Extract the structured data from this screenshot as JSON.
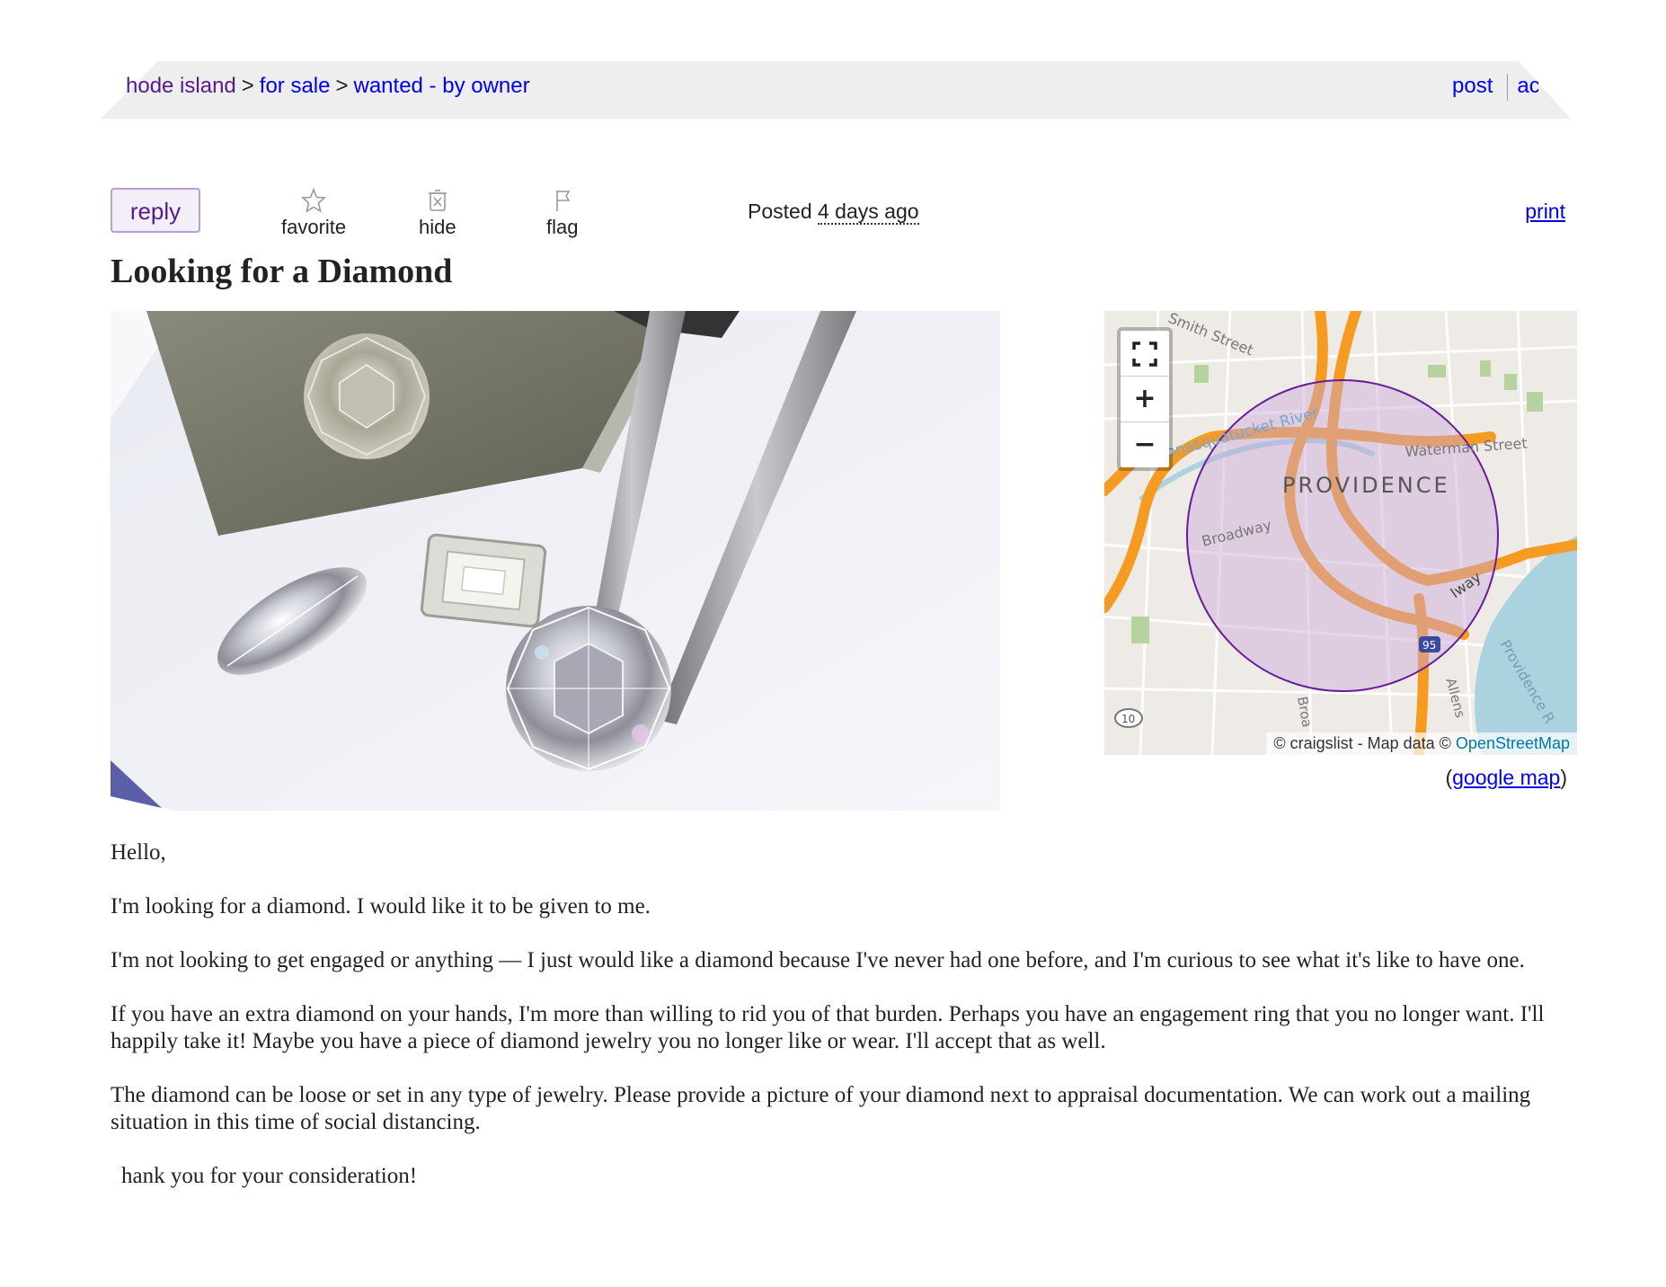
{
  "breadcrumb": {
    "region": "hode island",
    "category": "for sale",
    "subcategory": "wanted - by owner",
    "separator": ">"
  },
  "header_links": {
    "post": "post",
    "account": "ac"
  },
  "actions": {
    "reply": "reply",
    "favorite": "favorite",
    "hide": "hide",
    "flag": "flag",
    "posted_label": "Posted",
    "posted_ago": "4 days ago",
    "print": "print"
  },
  "title": "Looking for a Diamond",
  "map": {
    "city_label": "PROVIDENCE",
    "street_labels": [
      "Waterman Street",
      "Broadway",
      "Woonasquatucket River",
      "Smith Street",
      "Iway",
      "Providence R",
      "Broa",
      "Allens"
    ],
    "route_shields": [
      "95",
      "10"
    ],
    "controls": {
      "fullscreen": "⛶",
      "zoom_in": "+",
      "zoom_out": "−"
    },
    "attribution_prefix": "© craigslist - Map data ©",
    "attribution_link": "OpenStreetMap",
    "google_map_open": "(",
    "google_map_link": "google map",
    "google_map_close": ")",
    "colors": {
      "circle_stroke": "#6a1b9a",
      "circle_fill": "#c9a7d9",
      "highway": "#f59b21",
      "water": "#aad3df",
      "land": "#eeebe6"
    }
  },
  "body": {
    "paragraphs": [
      "Hello,",
      "I'm looking for a diamond. I would like it to be given to me.",
      "I'm not looking to get engaged or anything — I just would like a diamond because I've never had one before, and I'm curious to see what it's like to have one.",
      "If you have an extra diamond on your hands, I'm more than willing to rid you of that burden. Perhaps you have an engagement ring that you no longer want. I'll happily take it! Maybe you have a piece of diamond jewelry you no longer like or wear. I'll accept that as well.",
      "The diamond can be loose or set in any type of jewelry. Please provide a picture of your diamond next to appraisal documentation. We can work out a mailing situation in this time of social distancing.",
      "hank you for your consideration!"
    ]
  },
  "colors": {
    "link": "#0000ee",
    "visited": "#551a8b",
    "topbar_bg": "#eeeeee",
    "reply_bg": "#f3eef8",
    "reply_border": "#b89fd0"
  }
}
